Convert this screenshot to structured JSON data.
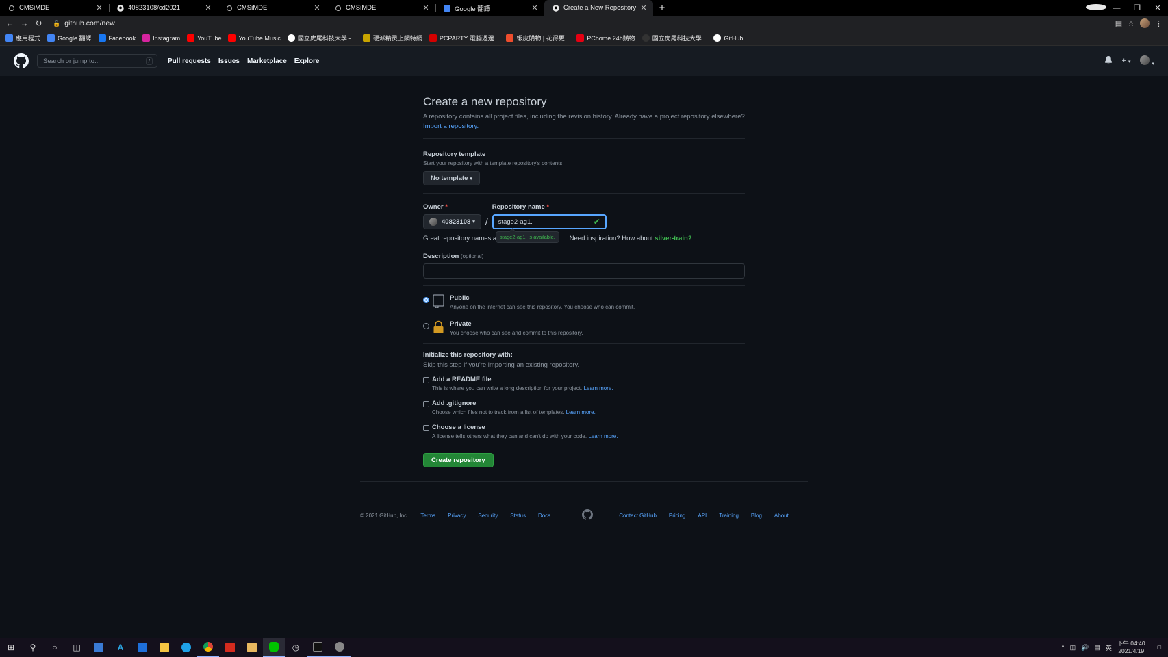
{
  "browser": {
    "tabs": [
      {
        "title": "CMSiMDE",
        "icon": "cmsimde-icon",
        "active": false
      },
      {
        "title": "40823108/cd2021",
        "icon": "github-icon",
        "active": false
      },
      {
        "title": "CMSiMDE",
        "icon": "cmsimde-icon",
        "active": false
      },
      {
        "title": "CMSiMDE",
        "icon": "cmsimde-icon",
        "active": false
      },
      {
        "title": "Google 翻譯",
        "icon": "google-translate-icon",
        "active": false
      },
      {
        "title": "Create a New Repository",
        "icon": "github-icon",
        "active": true
      }
    ],
    "url": "github.com/new",
    "bookmarks": [
      {
        "label": "應用程式",
        "icon": "apps-icon",
        "color": "#4285f4"
      },
      {
        "label": "Google 翻譯",
        "icon": "google-translate-icon",
        "color": "#4285f4"
      },
      {
        "label": "Facebook",
        "icon": "facebook-icon",
        "color": "#1877f2"
      },
      {
        "label": "Instagram",
        "icon": "instagram-icon",
        "color": "#d6249f"
      },
      {
        "label": "YouTube",
        "icon": "youtube-icon",
        "color": "#ff0000"
      },
      {
        "label": "YouTube Music",
        "icon": "youtube-music-icon",
        "color": "#ff0000"
      },
      {
        "label": "國立虎尾科技大學 -...",
        "icon": "nfu-icon",
        "color": "#ffffff"
      },
      {
        "label": "硬派精灵上網特網",
        "icon": "shield-icon",
        "color": "#c8a400"
      },
      {
        "label": "PCPARTY 電腦週邊...",
        "icon": "pcparty-icon",
        "color": "#d40000"
      },
      {
        "label": "蝦皮購物 | 花得更...",
        "icon": "shopee-icon",
        "color": "#ee4d2d"
      },
      {
        "label": "PChome 24h購物",
        "icon": "pchome-icon",
        "color": "#e60012"
      },
      {
        "label": "國立虎尾科技大學...",
        "icon": "nfu-icon",
        "color": "#333333"
      },
      {
        "label": "GitHub",
        "icon": "github-icon",
        "color": "#ffffff"
      }
    ]
  },
  "gh_header": {
    "search_placeholder": "Search or jump to...",
    "slash": "/",
    "nav": [
      "Pull requests",
      "Issues",
      "Marketplace",
      "Explore"
    ]
  },
  "form": {
    "title": "Create a new repository",
    "subtitle": "A repository contains all project files, including the revision history. Already have a project repository elsewhere?",
    "import_link": "Import a repository.",
    "template_label": "Repository template",
    "template_note": "Start your repository with a template repository's contents.",
    "template_button": "No template",
    "owner_label": "Owner",
    "owner_value": "40823108",
    "slash": "/",
    "repo_label": "Repository name",
    "repo_value": "stage2-ag1.",
    "tooltip": "stage2-ag1. is available.",
    "hint_prefix": "Great repository names ar",
    "hint_suffix": ". Need inspiration? How about",
    "suggestion": "silver-train?",
    "description_label": "Description",
    "optional": "(optional)",
    "public_title": "Public",
    "public_desc": "Anyone on the internet can see this repository. You choose who can commit.",
    "private_title": "Private",
    "private_desc": "You choose who can see and commit to this repository.",
    "init_title": "Initialize this repository with:",
    "init_note": "Skip this step if you're importing an existing repository.",
    "readme_title": "Add a README file",
    "readme_desc": "This is where you can write a long description for your project.",
    "gitignore_title": "Add .gitignore",
    "gitignore_desc": "Choose which files not to track from a list of templates.",
    "license_title": "Choose a license",
    "license_desc": "A license tells others what they can and can't do with your code.",
    "learn_more": "Learn more.",
    "submit": "Create repository"
  },
  "footer": {
    "copyright": "© 2021 GitHub, Inc.",
    "left_links": [
      "Terms",
      "Privacy",
      "Security",
      "Status",
      "Docs"
    ],
    "right_links": [
      "Contact GitHub",
      "Pricing",
      "API",
      "Training",
      "Blog",
      "About"
    ]
  },
  "taskbar": {
    "clock_time": "下午 04:40",
    "clock_date": "2021/4/19",
    "lang": "英"
  }
}
